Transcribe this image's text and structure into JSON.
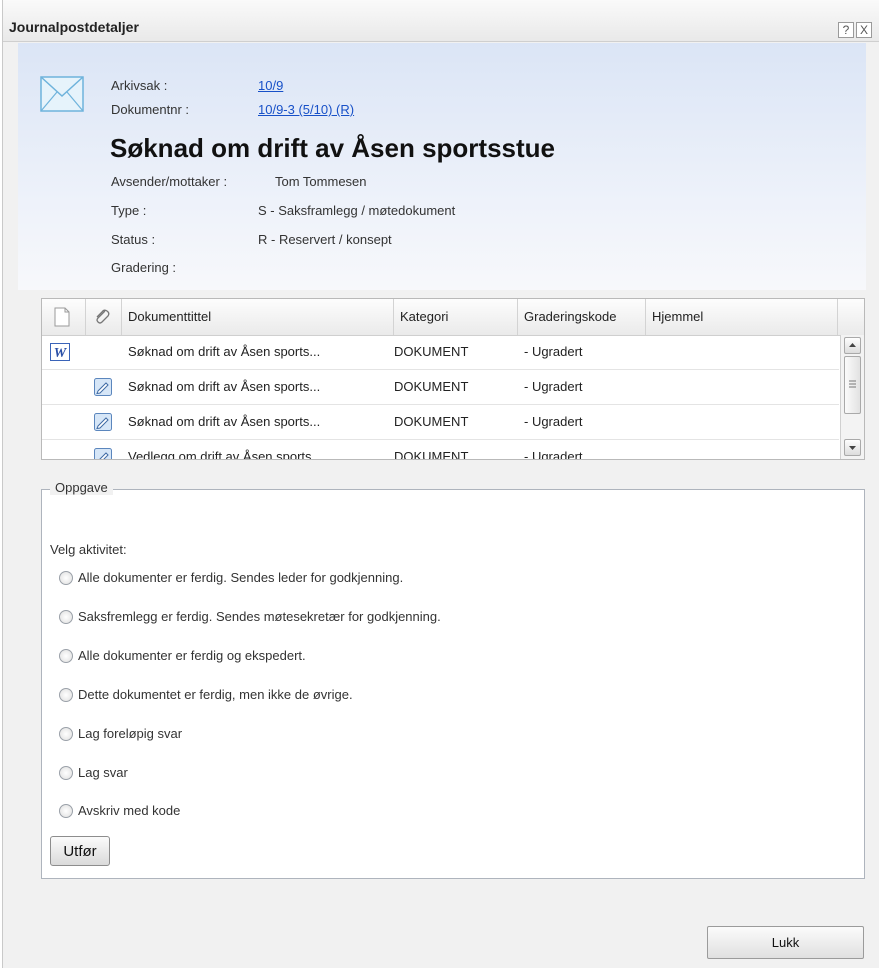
{
  "window": {
    "title": "Journalpostdetaljer",
    "help_glyph": "?",
    "close_glyph": "X"
  },
  "header": {
    "arkivsak_label": "Arkivsak :",
    "arkivsak_value": "10/9",
    "dokumentnr_label": "Dokumentnr :",
    "dokumentnr_value": "10/9-3 (5/10) (R)",
    "title": "Søknad om drift av Åsen sportsstue",
    "avsender_label": "Avsender/mottaker :",
    "avsender_value": "Tom Tommesen",
    "type_label": "Type :",
    "type_value": "S - Saksframlegg / møtedokument",
    "status_label": "Status :",
    "status_value": "R - Reservert / konsept",
    "gradering_label": "Gradering :",
    "gradering_value": ""
  },
  "grid": {
    "columns": [
      "Dokumenttittel",
      "Kategori",
      "Graderingskode",
      "Hjemmel"
    ],
    "rows": [
      {
        "icon": "word-doc-icon",
        "title": "Søknad om drift av Åsen sports...",
        "kategori": "DOKUMENT",
        "gradering": "- Ugradert",
        "hjemmel": ""
      },
      {
        "icon": "attachment-edit-icon",
        "title": "Søknad om drift av Åsen sports...",
        "kategori": "DOKUMENT",
        "gradering": "- Ugradert",
        "hjemmel": ""
      },
      {
        "icon": "attachment-edit-icon",
        "title": "Søknad om drift av Åsen sports...",
        "kategori": "DOKUMENT",
        "gradering": "- Ugradert",
        "hjemmel": ""
      },
      {
        "icon": "attachment-edit-icon",
        "title": "Vedlegg om drift av Åsen sports...",
        "kategori": "DOKUMENT",
        "gradering": "- Ugradert",
        "hjemmel": ""
      }
    ]
  },
  "task": {
    "legend": "Oppgave",
    "velg_label": "Velg aktivitet:",
    "options": [
      "Alle dokumenter er ferdig. Sendes leder for godkjenning.",
      "Saksfremlegg er ferdig. Sendes møtesekretær for godkjenning.",
      "Alle dokumenter er ferdig og ekspedert.",
      "Dette dokumentet er ferdig, men ikke de øvrige.",
      "Lag foreløpig svar",
      "Lag svar",
      "Avskriv med kode"
    ],
    "submit_label": "Utfør"
  },
  "footer": {
    "close_label": "Lukk"
  }
}
